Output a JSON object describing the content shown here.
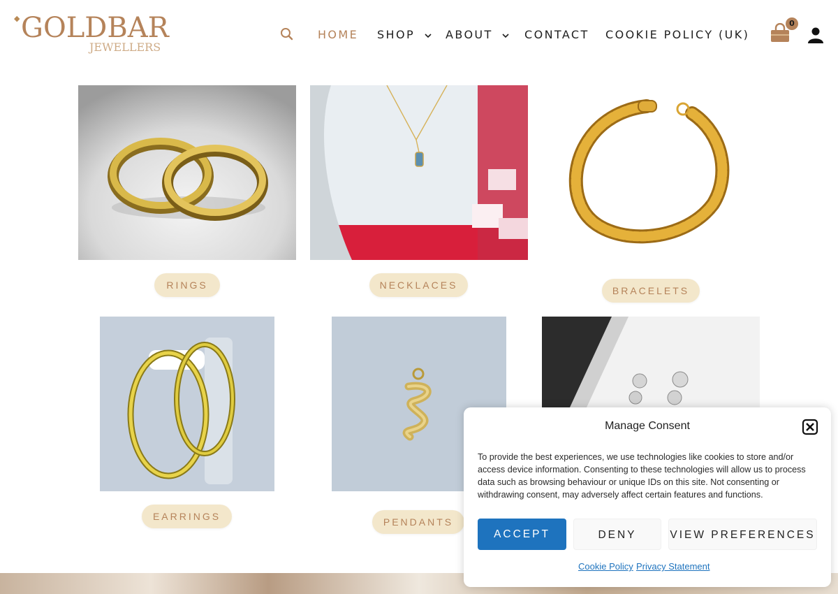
{
  "header": {
    "logo_text": "GOLDBAR",
    "logo_sub": "JEWELLERS",
    "nav": {
      "home": "HOME",
      "shop": "SHOP",
      "about": "ABOUT",
      "contact": "CONTACT",
      "cookie_policy": "COOKIE POLICY (UK)"
    },
    "cart_count": "0"
  },
  "categories": {
    "rings": "RINGS",
    "necklaces": "NECKLACES",
    "bracelets": "BRACELETS",
    "earrings": "EARRINGS",
    "pendants": "PENDANTS"
  },
  "consent": {
    "title": "Manage Consent",
    "text": "To provide the best experiences, we use technologies like cookies to store and/or access device information. Consenting to these technologies will allow us to process data such as browsing behaviour or unique IDs on this site. Not consenting or withdrawing consent, may adversely affect certain features and functions.",
    "accept": "ACCEPT",
    "deny": "DENY",
    "preferences": "VIEW PREFERENCES",
    "cookie_policy_link": "Cookie Policy",
    "privacy_link": "Privacy Statement"
  },
  "icons": {
    "search": "search-icon",
    "cart": "shopping-bag-icon",
    "user": "user-icon",
    "close": "close-icon"
  },
  "colors": {
    "gold": "#b5835a",
    "button_bg": "#f3e7cb",
    "accept_blue": "#1e73be"
  }
}
